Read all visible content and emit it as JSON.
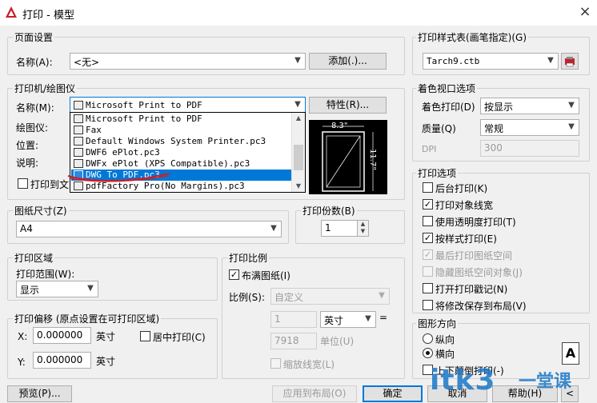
{
  "window": {
    "title": "打印 - 模型",
    "close": "×"
  },
  "page_setup": {
    "group": "页面设置",
    "name_label": "名称(A):",
    "name_value": "<无>",
    "add_button": "添加(.)..."
  },
  "printer": {
    "group": "打印机/绘图仪",
    "name_label": "名称(M):",
    "name_value": "Microsoft Print to PDF",
    "properties_button": "特性(R)...",
    "plotter_label": "绘图仪:",
    "location_label": "位置:",
    "description_label": "说明:",
    "print_to_file_label": "打印到文",
    "options": [
      "Microsoft Print to PDF",
      "Fax",
      "Default Windows System Printer.pc3",
      "DWF6 ePlot.pc3",
      "DWFx ePlot (XPS Compatible).pc3",
      "DWG To PDF.pc3",
      "pdfFactory Pro(No Margins).pc3"
    ],
    "selected_index": 5
  },
  "preview": {
    "width_label": "8.3\"",
    "height_label": "11.7\""
  },
  "paper_size": {
    "group": "图纸尺寸(Z)",
    "value": "A4"
  },
  "copies": {
    "group": "打印份数(B)",
    "value": "1"
  },
  "plot_area": {
    "group": "打印区域",
    "range_label": "打印范围(W):",
    "range_value": "显示"
  },
  "plot_offset": {
    "group": "打印偏移 (原点设置在可打印区域)",
    "x_label": "X:",
    "x_value": "0.000000",
    "x_unit": "英寸",
    "y_label": "Y:",
    "y_value": "0.000000",
    "y_unit": "英寸",
    "center_label": "居中打印(C)"
  },
  "plot_scale": {
    "group": "打印比例",
    "fit_label": "布满图纸(I)",
    "scale_label": "比例(S):",
    "scale_value": "自定义",
    "num_value": "1",
    "unit_value": "英寸",
    "equals": "=",
    "denom_value": "7918",
    "denom_unit": "单位(U)",
    "lineweight_label": "缩放线宽(L)"
  },
  "plot_style": {
    "group": "打印样式表(画笔指定)(G)",
    "value": "Tarch9.ctb"
  },
  "shaded_viewport": {
    "group": "着色视口选项",
    "shade_label": "着色打印(D)",
    "shade_value": "按显示",
    "quality_label": "质量(Q)",
    "quality_value": "常规",
    "dpi_label": "DPI",
    "dpi_value": "300"
  },
  "plot_options": {
    "group": "打印选项",
    "items": [
      {
        "label": "后台打印(K)",
        "checked": false,
        "disabled": false
      },
      {
        "label": "打印对象线宽",
        "checked": true,
        "disabled": false
      },
      {
        "label": "使用透明度打印(T)",
        "checked": false,
        "disabled": false
      },
      {
        "label": "按样式打印(E)",
        "checked": true,
        "disabled": false
      },
      {
        "label": "最后打印图纸空间",
        "checked": true,
        "disabled": true
      },
      {
        "label": "隐藏图纸空间对象(J)",
        "checked": false,
        "disabled": true
      },
      {
        "label": "打开打印戳记(N)",
        "checked": false,
        "disabled": false
      },
      {
        "label": "将修改保存到布局(V)",
        "checked": false,
        "disabled": false
      }
    ]
  },
  "orientation": {
    "group": "图形方向",
    "portrait": "纵向",
    "landscape": "横向",
    "upside_down": "上下颠倒打印(-)",
    "icon_letter": "A"
  },
  "footer": {
    "preview_button": "预览(P)...",
    "apply_button": "应用到布局(O)",
    "ok_button": "确定",
    "cancel_button": "取消",
    "help_button": "帮助(H)"
  },
  "watermark": {
    "text": "itk3",
    "subtitle": "一堂课"
  },
  "colors": {
    "accent": "#0078d7",
    "title_icon": "#c8202a",
    "watermark": "#1a78c8"
  }
}
